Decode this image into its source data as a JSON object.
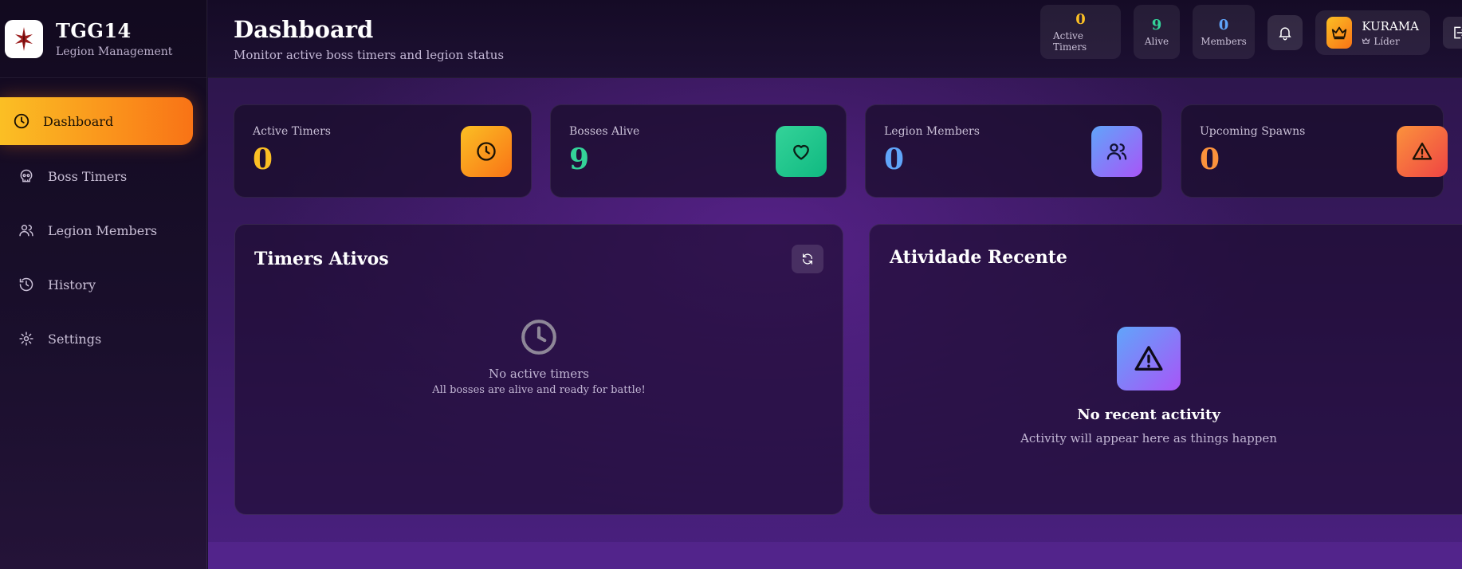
{
  "brand": {
    "title": "TGG14",
    "subtitle": "Legion Management",
    "logo_icon": "crest-logo"
  },
  "sidebar": {
    "items": [
      {
        "label": "Dashboard",
        "icon": "clock-icon",
        "active": true
      },
      {
        "label": "Boss Timers",
        "icon": "skull-icon"
      },
      {
        "label": "Legion Members",
        "icon": "users-icon"
      },
      {
        "label": "History",
        "icon": "history-icon"
      },
      {
        "label": "Settings",
        "icon": "gear-icon"
      }
    ]
  },
  "header": {
    "title": "Dashboard",
    "subtitle": "Monitor active boss timers and legion status",
    "mini_stats": [
      {
        "value": "0",
        "label": "Active Timers",
        "color": "#fbbf24"
      },
      {
        "value": "9",
        "label": "Alive",
        "color": "#34d399"
      },
      {
        "value": "0",
        "label": "Members",
        "color": "#60a5fa"
      }
    ],
    "user": {
      "name": "KURAMA",
      "role": "Líder"
    }
  },
  "stats": [
    {
      "label": "Active Timers",
      "value": "0",
      "color": "#fbbf24",
      "icon": "clock-icon",
      "icon_bg": [
        "#fbbf24",
        "#f97316"
      ]
    },
    {
      "label": "Bosses Alive",
      "value": "9",
      "color": "#34d399",
      "icon": "heart-icon",
      "icon_bg": [
        "#34d399",
        "#10b981"
      ]
    },
    {
      "label": "Legion Members",
      "value": "0",
      "color": "#60a5fa",
      "icon": "users-icon",
      "icon_bg": [
        "#60a5fa",
        "#a855f7"
      ]
    },
    {
      "label": "Upcoming Spawns",
      "value": "0",
      "color": "#fb923c",
      "icon": "warning-icon",
      "icon_bg": [
        "#fb923c",
        "#ef4444"
      ]
    }
  ],
  "timers_panel": {
    "title": "Timers Ativos",
    "empty_title": "No active timers",
    "empty_sub": "All bosses are alive and ready for battle!"
  },
  "activity_panel": {
    "title": "Atividade Recente",
    "empty_title": "No recent activity",
    "empty_sub": "Activity will appear here as things happen"
  }
}
